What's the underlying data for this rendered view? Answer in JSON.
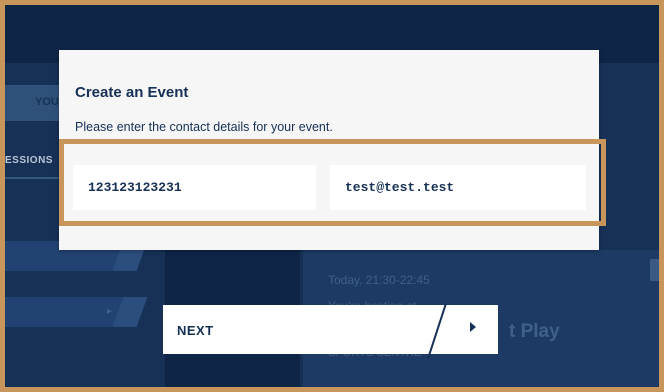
{
  "background": {
    "tab_label": "YOU",
    "sessions_label": "ESSIONS",
    "today_text": "Today, 21:30-22:45",
    "hosting_text": "You're hosting at",
    "play_text": "t Play",
    "small_text": "SPORTS CENTRE",
    "row_arrow": "▸"
  },
  "modal": {
    "title": "Create an Event",
    "subtitle": "Please enter the contact details for your event.",
    "phone_value": "123123123231",
    "email_value": "test@test.test"
  },
  "next_button": {
    "label": "NEXT"
  },
  "colors": {
    "frame": "#c8955a",
    "navy": "#163056",
    "modal_bg": "#f6f6f6"
  }
}
